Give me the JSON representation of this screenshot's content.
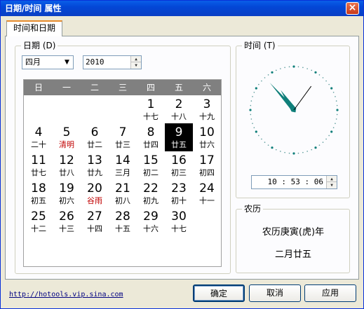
{
  "window": {
    "title": "日期/时间 属性",
    "close": "×"
  },
  "tab": {
    "label": "时间和日期"
  },
  "date_group": {
    "label": "日期 (D)",
    "month": "四月",
    "year": "2010"
  },
  "calendar": {
    "weekdays": [
      "日",
      "一",
      "二",
      "三",
      "四",
      "五",
      "六"
    ],
    "selected_day": "9",
    "rows": [
      [
        null,
        null,
        null,
        null,
        {
          "d": "1",
          "l": "十七"
        },
        {
          "d": "2",
          "l": "十八"
        },
        {
          "d": "3",
          "l": "十九"
        }
      ],
      [
        {
          "d": "4",
          "l": "二十"
        },
        {
          "d": "5",
          "l": "清明",
          "red": true
        },
        {
          "d": "6",
          "l": "廿二"
        },
        {
          "d": "7",
          "l": "廿三"
        },
        {
          "d": "8",
          "l": "廿四"
        },
        {
          "d": "9",
          "l": "廿五"
        },
        {
          "d": "10",
          "l": "廿六"
        }
      ],
      [
        {
          "d": "11",
          "l": "廿七"
        },
        {
          "d": "12",
          "l": "廿八"
        },
        {
          "d": "13",
          "l": "廿九"
        },
        {
          "d": "14",
          "l": "三月"
        },
        {
          "d": "15",
          "l": "初二"
        },
        {
          "d": "16",
          "l": "初三"
        },
        {
          "d": "17",
          "l": "初四"
        }
      ],
      [
        {
          "d": "18",
          "l": "初五"
        },
        {
          "d": "19",
          "l": "初六"
        },
        {
          "d": "20",
          "l": "谷雨",
          "red": true
        },
        {
          "d": "21",
          "l": "初八"
        },
        {
          "d": "22",
          "l": "初九"
        },
        {
          "d": "23",
          "l": "初十"
        },
        {
          "d": "24",
          "l": "十一"
        }
      ],
      [
        {
          "d": "25",
          "l": "十二"
        },
        {
          "d": "26",
          "l": "十三"
        },
        {
          "d": "27",
          "l": "十四"
        },
        {
          "d": "28",
          "l": "十五"
        },
        {
          "d": "29",
          "l": "十六"
        },
        {
          "d": "30",
          "l": "十七"
        },
        null
      ]
    ]
  },
  "time_group": {
    "label": "时间 (T)",
    "time": "10 : 53 : 06"
  },
  "lunar_group": {
    "label": "农历",
    "year_text": "农历庚寅(虎)年",
    "date_text": "二月廿五"
  },
  "footer": {
    "link": "http://hotools.vip.sina.com",
    "ok": "确定",
    "cancel": "取消",
    "apply": "应用"
  },
  "colors": {
    "hand": "#0f7f7a",
    "accent": "#e68b2c",
    "selected_bg": "#000000",
    "festival": "#c00000"
  }
}
